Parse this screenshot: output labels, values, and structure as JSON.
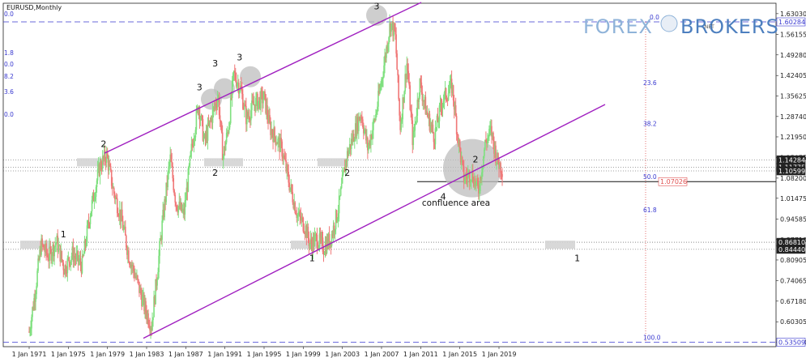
{
  "chart_title": "EURUSD,Monthly",
  "logo": {
    "part1": "FOREX",
    "part2": "BROKERS",
    "badge": ".NET"
  },
  "colors": {
    "up": "#7fe07f",
    "down": "#f07878",
    "channel": "#a020c0",
    "dash": "#3a3ad0",
    "fib_vertical": "#e05050"
  },
  "left_fib_labels": [
    "0.0",
    "1.8",
    "0.0",
    "8.2",
    "3.6",
    "0.0"
  ],
  "chart_data": {
    "type": "line",
    "title": "EURUSD,Monthly",
    "x": [
      "1 Jan 1971",
      "1 Jan 1975",
      "1 Jan 1979",
      "1 Jan 1983",
      "1 Jan 1987",
      "1 Jan 1991",
      "1 Jan 1995",
      "1 Jan 1999",
      "1 Jan 2003",
      "1 Jan 2007",
      "1 Jan 2011",
      "1 Jan 2015",
      "1 Jan 2019"
    ],
    "series": [
      {
        "values": [
          0.548,
          0.88,
          1.15,
          0.585,
          1.05,
          1.34,
          1.25,
          0.88,
          1.18,
          1.58,
          1.4,
          1.08,
          1.12
        ]
      }
    ],
    "y_ticks": [
      "1.63030",
      "1.56155",
      "1.49280",
      "1.42405",
      "1.35625",
      "1.28740",
      "1.21950",
      "1.15075",
      "1.08200",
      "1.01475",
      "0.94585",
      "0.87710",
      "0.80905",
      "0.74065",
      "0.67180",
      "0.60305",
      "0.53550"
    ],
    "ylim": [
      0.52,
      1.665
    ],
    "price_tags": [
      {
        "value": "1.60284",
        "style": "blue"
      },
      {
        "value": "1.14284",
        "style": "dark"
      },
      {
        "value": "1.11775",
        "style": "dark"
      },
      {
        "value": "1.10599",
        "style": "dark"
      },
      {
        "value": "1.07026",
        "style": "red"
      },
      {
        "value": "0.86810",
        "style": "dark"
      },
      {
        "value": "0.84440",
        "style": "dark"
      },
      {
        "value": "0.53509",
        "style": "blue"
      }
    ],
    "fib_levels": [
      {
        "label": "0.0",
        "value": 1.6028
      },
      {
        "label": "23.6",
        "value": 1.3835
      },
      {
        "label": "38.2",
        "value": 1.2478
      },
      {
        "label": "50.0",
        "value": 1.0703
      },
      {
        "label": "61.8",
        "value": 0.9605
      },
      {
        "label": "100.0",
        "value": 0.5351
      }
    ],
    "annotations": {
      "waves": [
        {
          "text": "1",
          "year": 1974.5,
          "value": 0.885
        },
        {
          "text": "2",
          "year": 1978.6,
          "value": 1.185
        },
        {
          "text": "3",
          "year": 1988.4,
          "value": 1.375
        },
        {
          "text": "3",
          "year": 1990.0,
          "value": 1.455
        },
        {
          "text": "3",
          "year": 1992.5,
          "value": 1.475
        },
        {
          "text": "2",
          "year": 1990.0,
          "value": 1.09
        },
        {
          "text": "1",
          "year": 1999.9,
          "value": 0.805
        },
        {
          "text": "2",
          "year": 2003.5,
          "value": 1.09
        },
        {
          "text": "3",
          "year": 2006.5,
          "value": 1.645
        },
        {
          "text": "4",
          "year": 2013.3,
          "value": 1.01
        },
        {
          "text": "2",
          "year": 2016.6,
          "value": 1.135
        },
        {
          "text": "1",
          "year": 2027.0,
          "value": 0.805
        }
      ],
      "confluence_label": "confluence area"
    }
  }
}
